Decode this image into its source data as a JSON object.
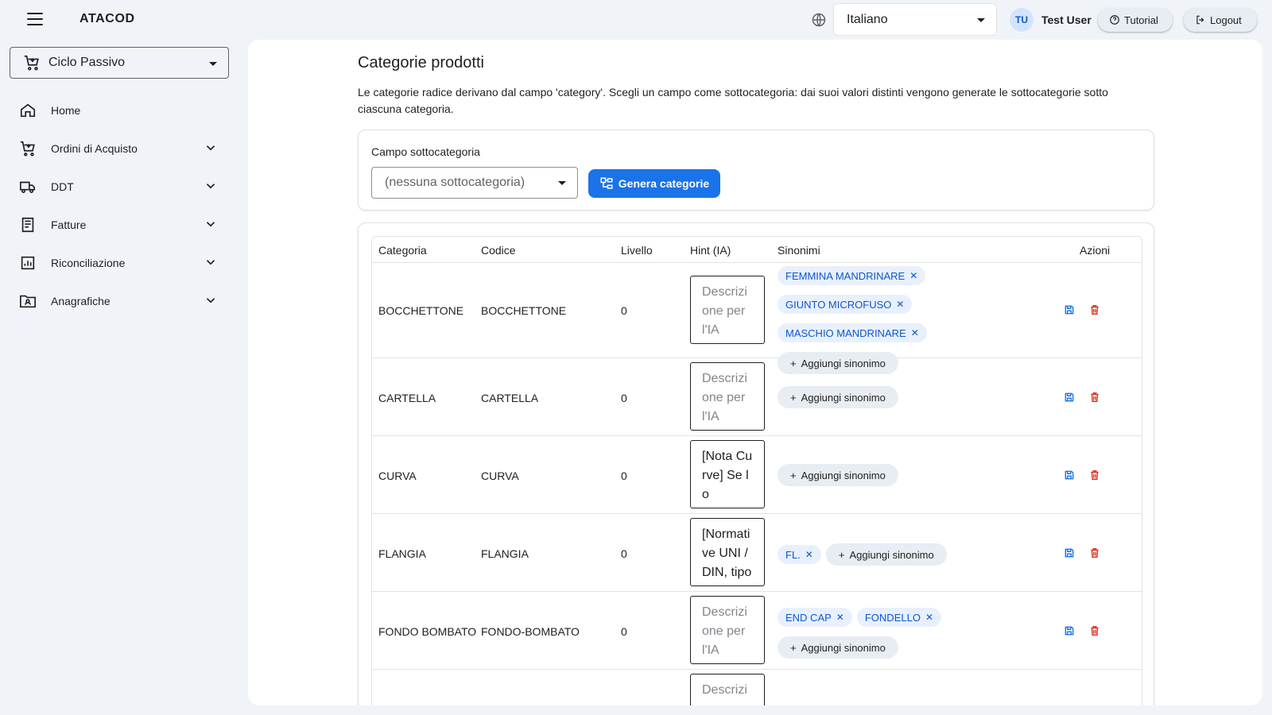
{
  "app": {
    "title": "ATACOD"
  },
  "header": {
    "language": "Italiano",
    "user_initials": "TU",
    "user_name": "Test User",
    "tutorial_label": "Tutorial",
    "logout_label": "Logout"
  },
  "sidebar": {
    "module": "Ciclo Passivo",
    "items": [
      {
        "label": "Home",
        "icon": "home-icon"
      },
      {
        "label": "Ordini di Acquisto",
        "icon": "cart-icon"
      },
      {
        "label": "DDT",
        "icon": "truck-icon"
      },
      {
        "label": "Fatture",
        "icon": "receipt-icon"
      },
      {
        "label": "Riconciliazione",
        "icon": "chart-icon"
      },
      {
        "label": "Anagrafiche",
        "icon": "folder-user-icon"
      }
    ]
  },
  "main": {
    "title": "Categorie prodotti",
    "description": "Le categorie radice derivano dal campo 'category'. Scegli un campo come sottocategoria: dai suoi valori distinti vengono generate le sottocategorie sotto ciascuna categoria.",
    "subcategory_label": "Campo sottocategoria",
    "subcategory_value": "(nessuna sottocategoria)",
    "generate_label": "Genera categorie",
    "table": {
      "headers": [
        "Categoria",
        "Codice",
        "Livello",
        "Hint (IA)",
        "Sinonimi",
        "Azioni"
      ],
      "add_synonym_label": "Aggiungi sinonimo",
      "hint_placeholder": "Descrizione per l'IA",
      "rows": [
        {
          "categoria": "BOCCHETTONE",
          "codice": "BOCCHETTONE",
          "livello": "0",
          "hint": "",
          "sinonimi": [
            "FEMMINA MANDRINARE",
            "GIUNTO MICROFUSO",
            "MASCHIO MANDRINARE"
          ]
        },
        {
          "categoria": "CARTELLA",
          "codice": "CARTELLA",
          "livello": "0",
          "hint": "",
          "sinonimi": []
        },
        {
          "categoria": "CURVA",
          "codice": "CURVA",
          "livello": "0",
          "hint": "[Nota Curve] Se lo",
          "sinonimi": []
        },
        {
          "categoria": "FLANGIA",
          "codice": "FLANGIA",
          "livello": "0",
          "hint": "[Normative UNI / DIN, tipo fl",
          "sinonimi": [
            "FL."
          ]
        },
        {
          "categoria": "FONDO BOMBATO",
          "codice": "FONDO-BOMBATO",
          "livello": "0",
          "hint": "",
          "sinonimi": [
            "END CAP",
            "FONDELLO"
          ]
        },
        {
          "categoria": "",
          "codice": "",
          "livello": "",
          "hint": "",
          "sinonimi": []
        }
      ]
    }
  },
  "colors": {
    "primary": "#1a73e8",
    "danger": "#d93025",
    "chip_bg": "#e8f0fe",
    "background": "#f0f4f9"
  }
}
